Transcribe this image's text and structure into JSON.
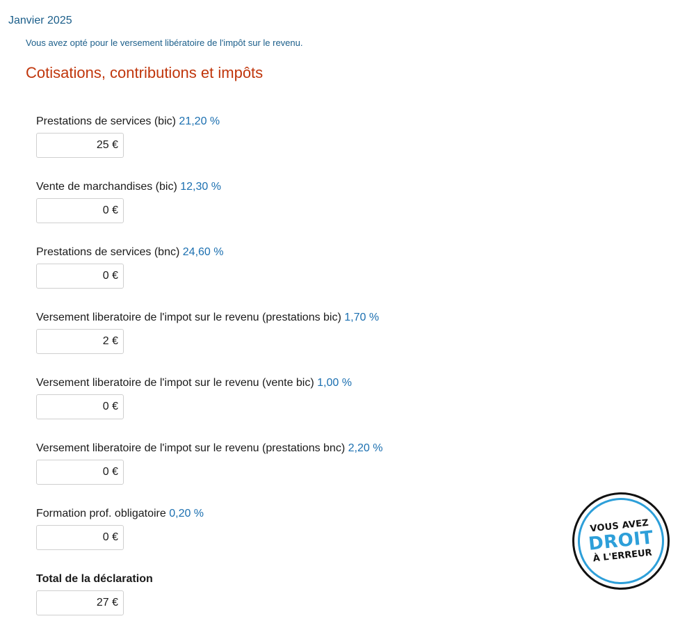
{
  "header": {
    "month": "Janvier 2025",
    "option_note": "Vous avez opté pour le versement libératoire de l'impôt sur le revenu.",
    "section_title": "Cotisations, contributions et impôts"
  },
  "fields": [
    {
      "label": "Prestations de services (bic)",
      "rate": "21,20 %",
      "amount": "25 €"
    },
    {
      "label": "Vente de marchandises (bic)",
      "rate": "12,30 %",
      "amount": "0 €"
    },
    {
      "label": "Prestations de services (bnc)",
      "rate": "24,60 %",
      "amount": "0 €"
    },
    {
      "label": "Versement liberatoire de l'impot sur le revenu (prestations bic)",
      "rate": "1,70 %",
      "amount": "2 €"
    },
    {
      "label": "Versement liberatoire de l'impot sur le revenu (vente bic)",
      "rate": "1,00 %",
      "amount": "0 €"
    },
    {
      "label": "Versement liberatoire de l'impot sur le revenu (prestations bnc)",
      "rate": "2,20 %",
      "amount": "0 €"
    },
    {
      "label": "Formation prof. obligatoire",
      "rate": "0,20 %",
      "amount": "0 €"
    }
  ],
  "total": {
    "label": "Total de la déclaration",
    "amount": "27 €"
  },
  "badge": {
    "line1": "VOUS AVEZ",
    "line2": "DROIT",
    "line3": "À L'ERREUR"
  },
  "colors": {
    "link_blue": "#1b5e8a",
    "rate_blue": "#1b6fb0",
    "heading_red": "#c0360c",
    "badge_blue": "#2d9fd9"
  }
}
